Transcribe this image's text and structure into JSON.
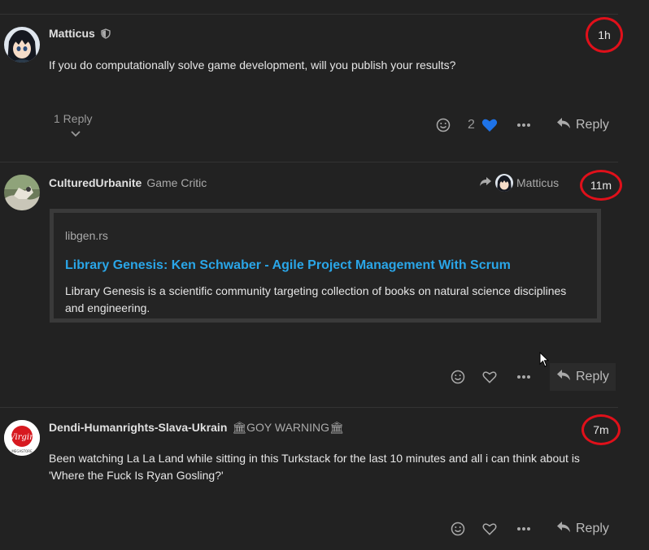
{
  "posts": [
    {
      "username": "Matticus",
      "timestamp": "1h",
      "body": "If you do computationally solve game development, will you publish your results?",
      "replies_label": "1 Reply",
      "like_count": "2",
      "reply_label": "Reply"
    },
    {
      "username": "CulturedUrbanite",
      "user_title": "Game Critic",
      "reply_to": "Matticus",
      "timestamp": "11m",
      "onebox": {
        "source": "libgen.rs",
        "title": "Library Genesis: Ken Schwaber - Agile Project Management With Scrum",
        "description": "Library Genesis is a scientific community targeting collection of books on natural science disciplines and engineering."
      },
      "reply_label": "Reply"
    },
    {
      "username": "Dendi-Humanrights-Slava-Ukrain",
      "user_title": "🏛GOY WARNING🏛",
      "timestamp": "7m",
      "body": "Been watching La La Land while sitting in this Turkstack for the last 10 minutes and all i can think about is 'Where the Fuck Is Ryan Gosling?'",
      "reply_label": "Reply"
    }
  ],
  "colors": {
    "background": "#222222",
    "link": "#2aa6e8",
    "like_active": "#1e73e8",
    "highlight_circle": "#e0101a"
  },
  "avatar3_text": "Virgin",
  "avatar3_subtext": "MEGASTORE"
}
